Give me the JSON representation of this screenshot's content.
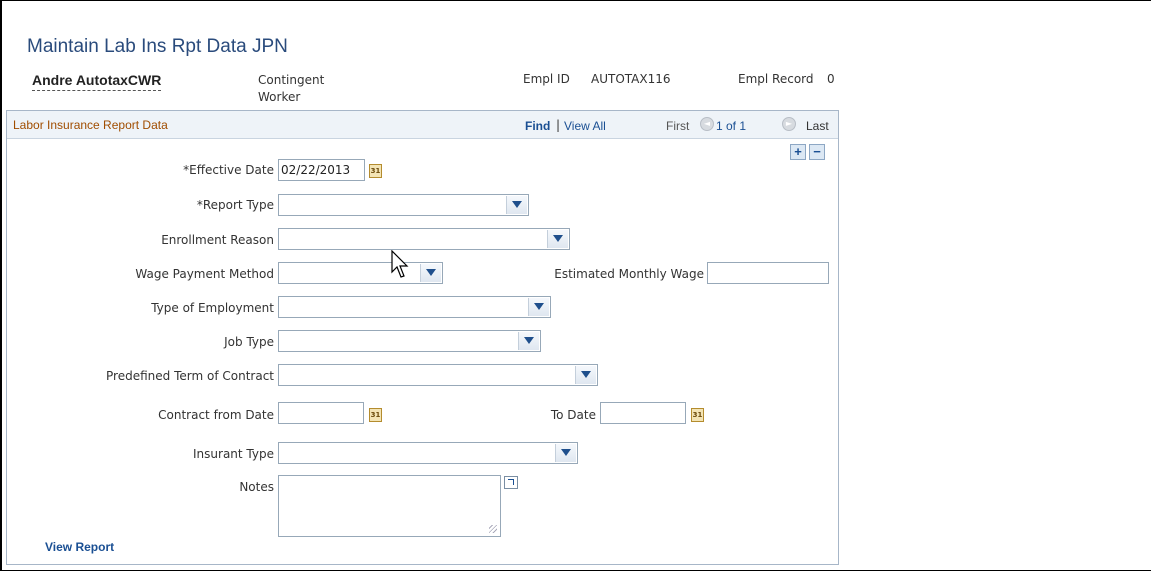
{
  "page": {
    "title": "Maintain Lab Ins Rpt Data JPN"
  },
  "employee": {
    "name": "Andre AutotaxCWR",
    "type_line1": "Contingent",
    "type_line2": "Worker",
    "empl_id_label": "Empl ID",
    "empl_id": "AUTOTAX116",
    "empl_record_label": "Empl Record",
    "empl_record": "0"
  },
  "panel": {
    "title": "Labor Insurance Report Data",
    "nav": {
      "find": "Find",
      "separator": "|",
      "view_all": "View All",
      "first": "First",
      "count": "1 of 1",
      "last": "Last"
    }
  },
  "form": {
    "effective_date_label": "*Effective Date",
    "effective_date_value": "02/22/2013",
    "report_type_label": "*Report Type",
    "enrollment_reason_label": "Enrollment Reason",
    "wage_payment_method_label": "Wage Payment Method",
    "estimated_monthly_wage_label": "Estimated Monthly Wage",
    "type_of_employment_label": "Type of Employment",
    "job_type_label": "Job Type",
    "predefined_term_label": "Predefined Term of Contract",
    "contract_from_date_label": "Contract from Date",
    "to_date_label": "To Date",
    "insurant_type_label": "Insurant Type",
    "notes_label": "Notes",
    "calendar_glyph": "31"
  },
  "links": {
    "view_report": "View Report"
  },
  "icons": {
    "add_row": "+",
    "delete_row": "−",
    "prev": "◄",
    "next": "►"
  },
  "colors": {
    "title": "#2a4b7c",
    "panel_title": "#a04d00",
    "link": "#1a4f93",
    "panel_border": "#a7b6c8"
  }
}
